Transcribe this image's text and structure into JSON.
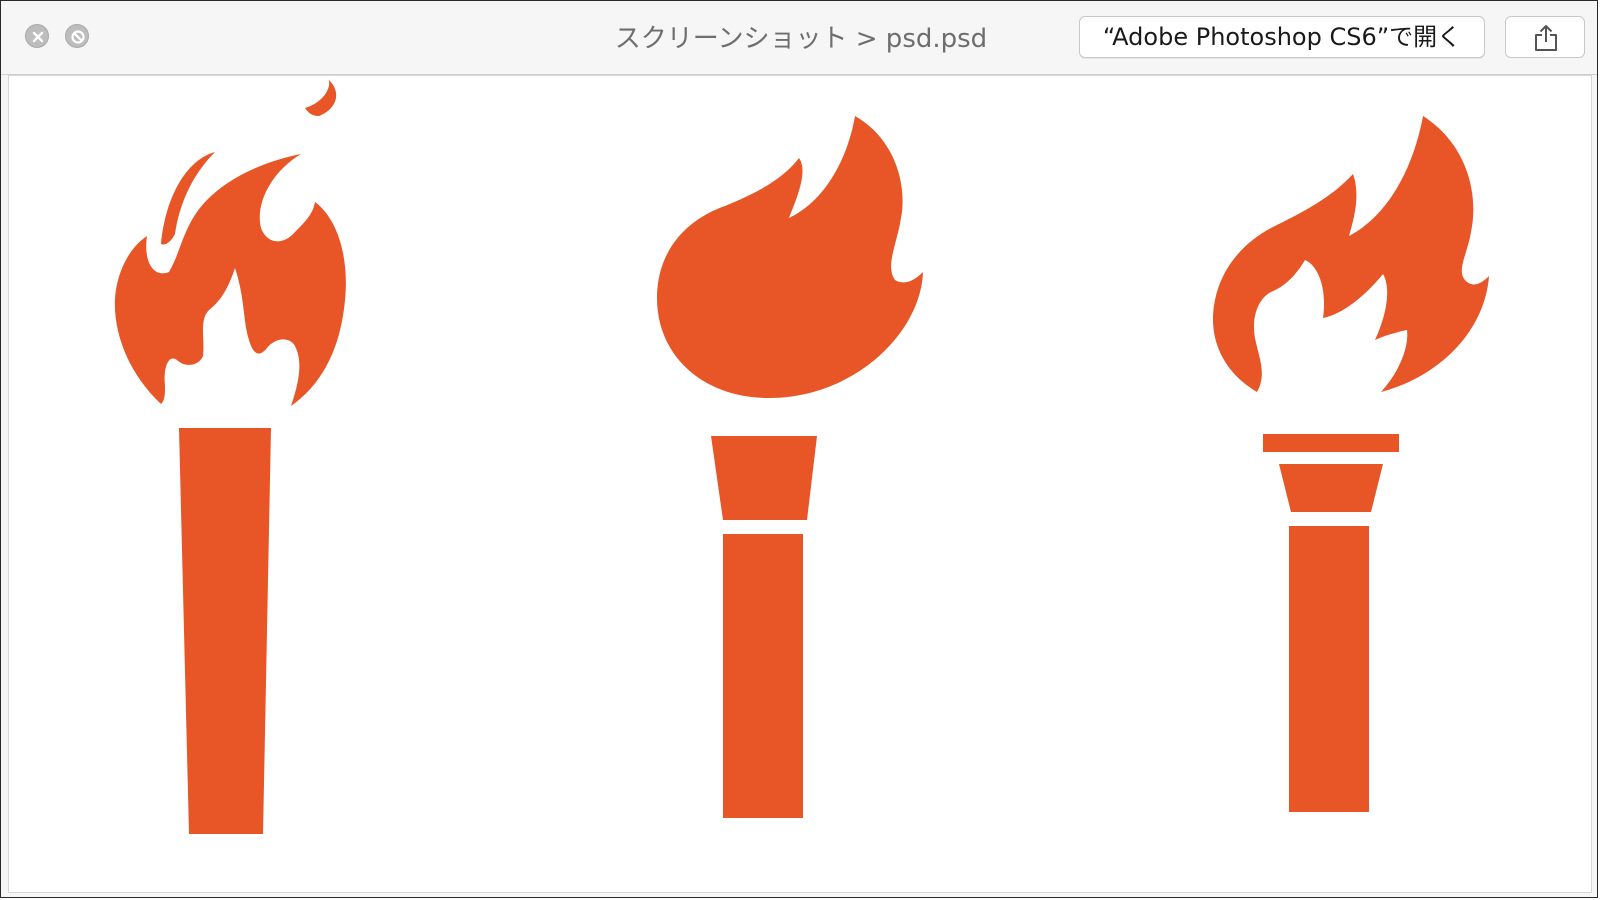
{
  "window": {
    "title": "スクリーンショット > psd.psd",
    "open_with_label": "“Adobe Photoshop CS6”で開く"
  },
  "icons": {
    "close": "close-icon",
    "minimize": "minimize-icon",
    "share": "share-icon"
  },
  "colors": {
    "torch": "#E85526",
    "background": "#FFFFFF"
  },
  "image": {
    "subject": "three torch icons",
    "torches": [
      "torch-1",
      "torch-2",
      "torch-3"
    ]
  }
}
